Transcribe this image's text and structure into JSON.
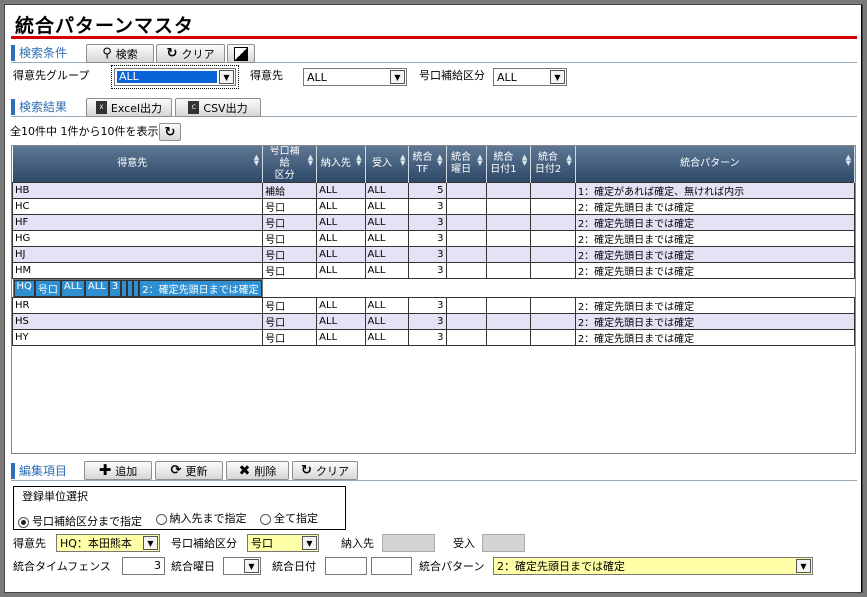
{
  "title": "統合パターンマスタ",
  "search": {
    "section_label": "検索条件",
    "search_button": "検索",
    "clear_button": "クリア",
    "group_label": "得意先グループ",
    "group_value": "ALL",
    "customer_label": "得意先",
    "customer_value": "ALL",
    "supply_label": "号口補給区分",
    "supply_value": "ALL"
  },
  "results": {
    "section_label": "検索結果",
    "excel_button": "Excel出力",
    "csv_button": "CSV出力",
    "count_text": "全10件中 1件から10件を表示"
  },
  "table": {
    "headers": [
      "得意先",
      "号口補給\n区分",
      "納入先",
      "受入",
      "統合\nTF",
      "統合\n曜日",
      "統合\n日付1",
      "統合\n日付2",
      "統合パターン"
    ],
    "rows": [
      [
        "HB",
        "補給",
        "ALL",
        "ALL",
        "5",
        "",
        "",
        "",
        "1：確定があれば確定、無ければ内示"
      ],
      [
        "HC",
        "号口",
        "ALL",
        "ALL",
        "3",
        "",
        "",
        "",
        "2：確定先頭日までは確定"
      ],
      [
        "HF",
        "号口",
        "ALL",
        "ALL",
        "3",
        "",
        "",
        "",
        "2：確定先頭日までは確定"
      ],
      [
        "HG",
        "号口",
        "ALL",
        "ALL",
        "3",
        "",
        "",
        "",
        "2：確定先頭日までは確定"
      ],
      [
        "HJ",
        "号口",
        "ALL",
        "ALL",
        "3",
        "",
        "",
        "",
        "2：確定先頭日までは確定"
      ],
      [
        "HM",
        "号口",
        "ALL",
        "ALL",
        "3",
        "",
        "",
        "",
        "2：確定先頭日までは確定"
      ],
      [
        "HQ",
        "号口",
        "ALL",
        "ALL",
        "3",
        "",
        "",
        "",
        "2：確定先頭日までは確定"
      ],
      [
        "HR",
        "号口",
        "ALL",
        "ALL",
        "3",
        "",
        "",
        "",
        "2：確定先頭日までは確定"
      ],
      [
        "HS",
        "号口",
        "ALL",
        "ALL",
        "3",
        "",
        "",
        "",
        "2：確定先頭日までは確定"
      ],
      [
        "HY",
        "号口",
        "ALL",
        "ALL",
        "3",
        "",
        "",
        "",
        "2：確定先頭日までは確定"
      ]
    ],
    "selected_row": 6
  },
  "edit": {
    "section_label": "編集項目",
    "add_button": "追加",
    "update_button": "更新",
    "delete_button": "削除",
    "clear_button": "クリア",
    "reg_unit_title": "登録単位選択",
    "radio1": "号口補給区分まで指定",
    "radio2": "納入先まで指定",
    "radio3": "全て指定",
    "customer_label": "得意先",
    "customer_value": "HQ：本田熊本",
    "supply_label": "号口補給区分",
    "supply_value": "号口",
    "delivery_label": "納入先",
    "receive_label": "受入",
    "tf_label": "統合タイムフェンス",
    "tf_value": "3",
    "weekday_label": "統合曜日",
    "date_label": "統合日付",
    "pattern_label": "統合パターン",
    "pattern_value": "2：確定先頭日までは確定"
  },
  "colors": {
    "accent": "#2e6fb6",
    "title_rule": "#d40000",
    "selected_row": "#2f8fd0",
    "highlight_field": "#ffffa8"
  }
}
